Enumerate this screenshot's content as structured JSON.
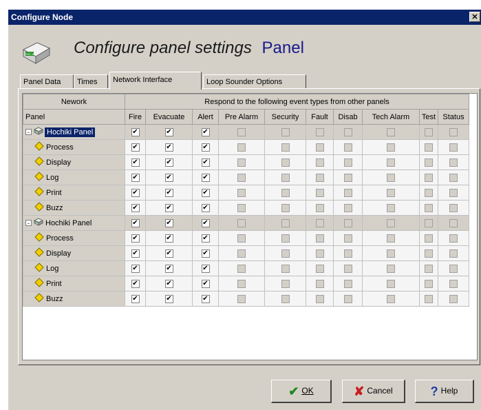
{
  "window": {
    "title": "Configure Node",
    "close": "✕"
  },
  "header": {
    "title": "Configure panel settings",
    "subtitle": "Panel"
  },
  "tabs": [
    {
      "label": "Panel Data"
    },
    {
      "label": "Times"
    },
    {
      "label": "Network Interface"
    },
    {
      "label": "Loop Sounder Options"
    }
  ],
  "grid": {
    "group_header_left": "Nework",
    "group_header_right": "Respond to the following event types from other panels",
    "name_header": "Panel",
    "columns": [
      "Fire",
      "Evacuate",
      "Alert",
      "Pre Alarm",
      "Security",
      "Fault",
      "Disab",
      "Tech Alarm",
      "Test",
      "Status"
    ],
    "rows": [
      {
        "type": "panel",
        "label": "Hochiki Panel",
        "selected": true,
        "expander": "-"
      },
      {
        "type": "item",
        "label": "Process"
      },
      {
        "type": "item",
        "label": "Display"
      },
      {
        "type": "item",
        "label": "Log"
      },
      {
        "type": "item",
        "label": "Print"
      },
      {
        "type": "item",
        "label": "Buzz"
      },
      {
        "type": "panel",
        "label": "Hochiki Panel",
        "selected": false,
        "expander": "-"
      },
      {
        "type": "item",
        "label": "Process"
      },
      {
        "type": "item",
        "label": "Display"
      },
      {
        "type": "item",
        "label": "Log"
      },
      {
        "type": "item",
        "label": "Print"
      },
      {
        "type": "item",
        "label": "Buzz"
      }
    ],
    "checked_columns": [
      "Fire",
      "Evacuate",
      "Alert"
    ]
  },
  "buttons": {
    "ok": "OK",
    "cancel": "Cancel",
    "help": "Help"
  },
  "colors": {
    "titlebar": "#0a246a",
    "face": "#d4d0c8",
    "ok_icon": "#1e8a1e",
    "cancel_icon": "#c81e1e",
    "help_icon": "#1e3ca0",
    "diamond": "#f0d000"
  }
}
